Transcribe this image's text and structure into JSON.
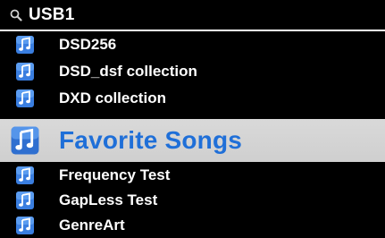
{
  "header": {
    "icon": "search-icon",
    "title": "USB1"
  },
  "list": {
    "items": [
      {
        "label": "DSD256",
        "icon": "music-folder-icon",
        "selected": false
      },
      {
        "label": "DSD_dsf collection",
        "icon": "music-folder-icon",
        "selected": false
      },
      {
        "label": "DXD collection",
        "icon": "music-folder-icon",
        "selected": false
      },
      {
        "label": "Favorite Songs",
        "icon": "music-folder-icon",
        "selected": true
      },
      {
        "label": "Frequency Test",
        "icon": "music-folder-icon",
        "selected": false
      },
      {
        "label": "GapLess Test",
        "icon": "music-folder-icon",
        "selected": false
      },
      {
        "label": "GenreArt",
        "icon": "music-folder-icon",
        "selected": false
      }
    ]
  },
  "colors": {
    "background": "#000000",
    "text": "#ffffff",
    "selected_bg": "#d4d4d4",
    "selected_text": "#1f6fd8",
    "icon_blue": "#3a7ee0"
  }
}
